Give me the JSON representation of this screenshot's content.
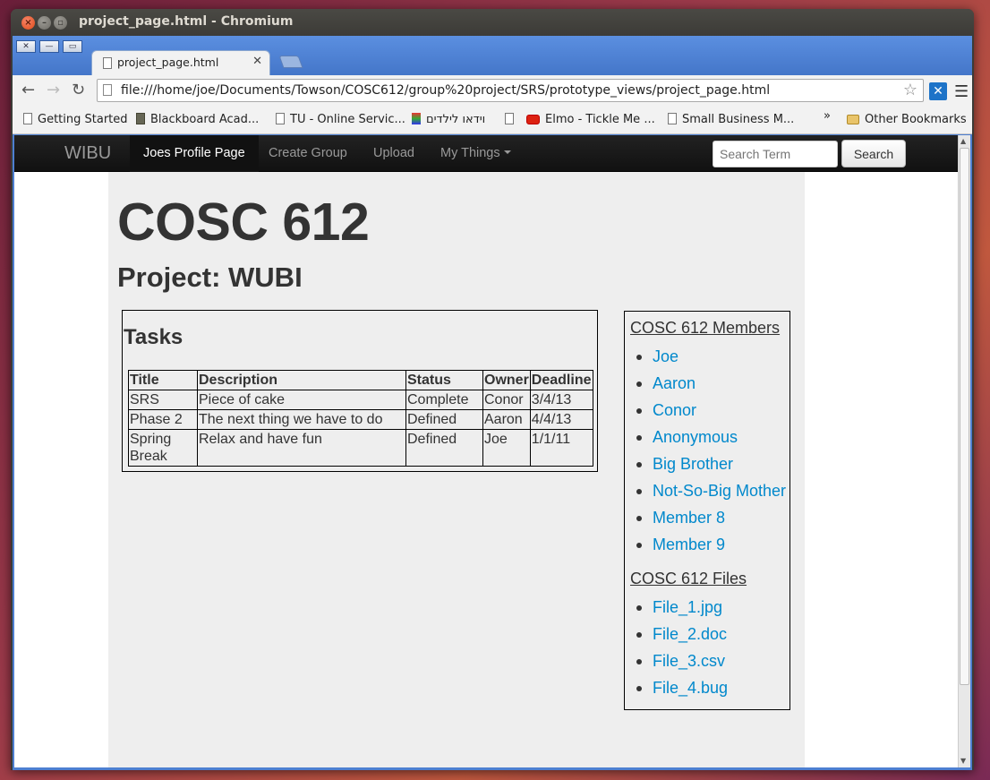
{
  "window": {
    "title": "project_page.html - Chromium"
  },
  "browser": {
    "tab_title": "project_page.html",
    "url": "file:///home/joe/Documents/Towson/COSC612/group%20project/SRS/prototype_views/project_page.html",
    "bookmarks": [
      {
        "label": "Getting Started",
        "icon": "page-icon"
      },
      {
        "label": "Blackboard Acad...",
        "icon": "blackboard-icon"
      },
      {
        "label": "TU - Online Servic...",
        "icon": "page-icon"
      },
      {
        "label": "וידאו לילדים",
        "icon": "colorful-icon"
      },
      {
        "label": "",
        "icon": "page-icon"
      },
      {
        "label": "Elmo - Tickle Me ...",
        "icon": "youtube-icon"
      },
      {
        "label": "Small Business M...",
        "icon": "page-icon"
      }
    ],
    "overflow_label": "»",
    "other_bookmarks": "Other Bookmarks"
  },
  "navbar": {
    "brand": "WIBU",
    "items": [
      "Joes Profile Page",
      "Create Group",
      "Upload",
      "My Things"
    ],
    "active_index": 0,
    "search_placeholder": "Search Term",
    "search_button": "Search"
  },
  "page": {
    "heading": "COSC 612",
    "subheading": "Project: WUBI",
    "tasks": {
      "title": "Tasks",
      "columns": [
        "Title",
        "Description",
        "Status",
        "Owner",
        "Deadline"
      ],
      "rows": [
        [
          "SRS",
          "Piece of cake",
          "Complete",
          "Conor",
          "3/4/13"
        ],
        [
          "Phase 2",
          "The next thing we have to do",
          "Defined",
          "Aaron",
          "4/4/13"
        ],
        [
          "Spring Break",
          "Relax and have fun",
          "Defined",
          "Joe",
          "1/1/11"
        ]
      ]
    },
    "members": {
      "title": "COSC 612 Members",
      "items": [
        "Joe",
        "Aaron",
        "Conor",
        "Anonymous",
        "Big Brother",
        "Not-So-Big Mother",
        "Member 8",
        "Member 9"
      ]
    },
    "files": {
      "title": "COSC 612 Files",
      "items": [
        "File_1.jpg",
        "File_2.doc",
        "File_3.csv",
        "File_4.bug"
      ]
    }
  }
}
